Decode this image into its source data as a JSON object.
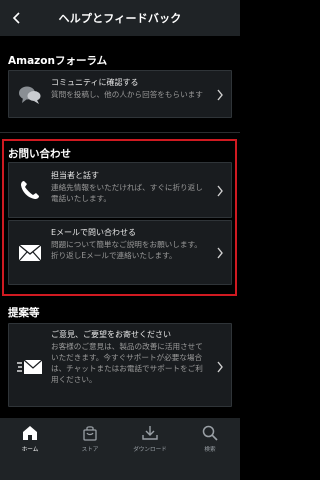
{
  "header": {
    "title": "ヘルプとフィードバック",
    "back_icon": "chevron-left-icon"
  },
  "sections": {
    "forum": {
      "title": "Amazonフォーラム",
      "card": {
        "title": "コミュニティに確認する",
        "desc": "質問を投稿し、他の人から回答をもらいます",
        "icon": "chat-bubbles-icon"
      }
    },
    "contact": {
      "title": "お問い合わせ",
      "cards": [
        {
          "title": "担当者と話す",
          "desc": "連絡先情報をいただければ、すぐに折り返し電話いたします。",
          "icon": "phone-icon"
        },
        {
          "title": "Eメールで問い合わせる",
          "desc": "問題について簡単なご説明をお願いします。折り返しEメールで連絡いたします。",
          "icon": "envelope-icon"
        }
      ]
    },
    "suggestions": {
      "title": "提案等",
      "card": {
        "title": "ご意見、ご要望をお寄せください",
        "desc": "お客様のご意見は、製品の改善に活用させていただきます。今すぐサポートが必要な場合は、チャットまたはお電話でサポートをご利用ください。",
        "icon": "send-mail-icon"
      }
    }
  },
  "nav": {
    "items": [
      {
        "label": "ホーム",
        "icon": "home-icon",
        "active": true
      },
      {
        "label": "ストア",
        "icon": "shopping-bag-icon",
        "active": false
      },
      {
        "label": "ダウンロード",
        "icon": "download-icon",
        "active": false
      },
      {
        "label": "検索",
        "icon": "search-icon",
        "active": false
      }
    ]
  },
  "colors": {
    "background": "#000000",
    "header": "#1f2326",
    "card": "#191c1f",
    "highlight": "#d01a21",
    "text_secondary": "#9a9a9a"
  }
}
